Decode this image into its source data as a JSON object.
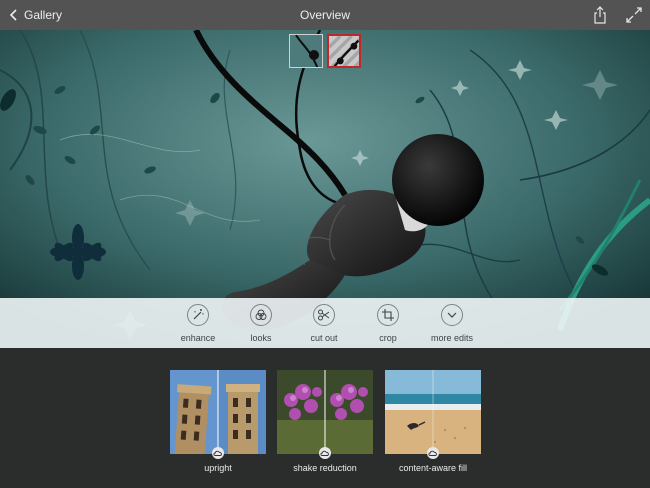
{
  "header": {
    "back_label": "Gallery",
    "title": "Overview",
    "back_icon": "chevron-left-icon",
    "share_icon": "share-icon",
    "expand_icon": "expand-icon"
  },
  "colors": {
    "topbar": "#535353",
    "toolbar_bg": "#f0f6f7",
    "bottom_bg": "#2b2c2c",
    "canvas_teal": "#2c5656",
    "selected_thumb_border": "#c0262a"
  },
  "canvas": {
    "thumbnails": [
      {
        "name": "original-thumbnail",
        "selected": false
      },
      {
        "name": "edited-thumbnail",
        "selected": true
      }
    ]
  },
  "toolbar": {
    "tools": [
      {
        "label": "enhance",
        "icon": "magic-wand-icon"
      },
      {
        "label": "looks",
        "icon": "looks-icon"
      },
      {
        "label": "cut out",
        "icon": "scissors-icon"
      },
      {
        "label": "crop",
        "icon": "crop-icon"
      },
      {
        "label": "more edits",
        "icon": "chevron-down-icon"
      }
    ]
  },
  "promos": [
    {
      "label": "upright",
      "icon": "creative-cloud-icon"
    },
    {
      "label": "shake reduction",
      "icon": "creative-cloud-icon"
    },
    {
      "label": "content-aware fill",
      "icon": "creative-cloud-icon"
    }
  ]
}
